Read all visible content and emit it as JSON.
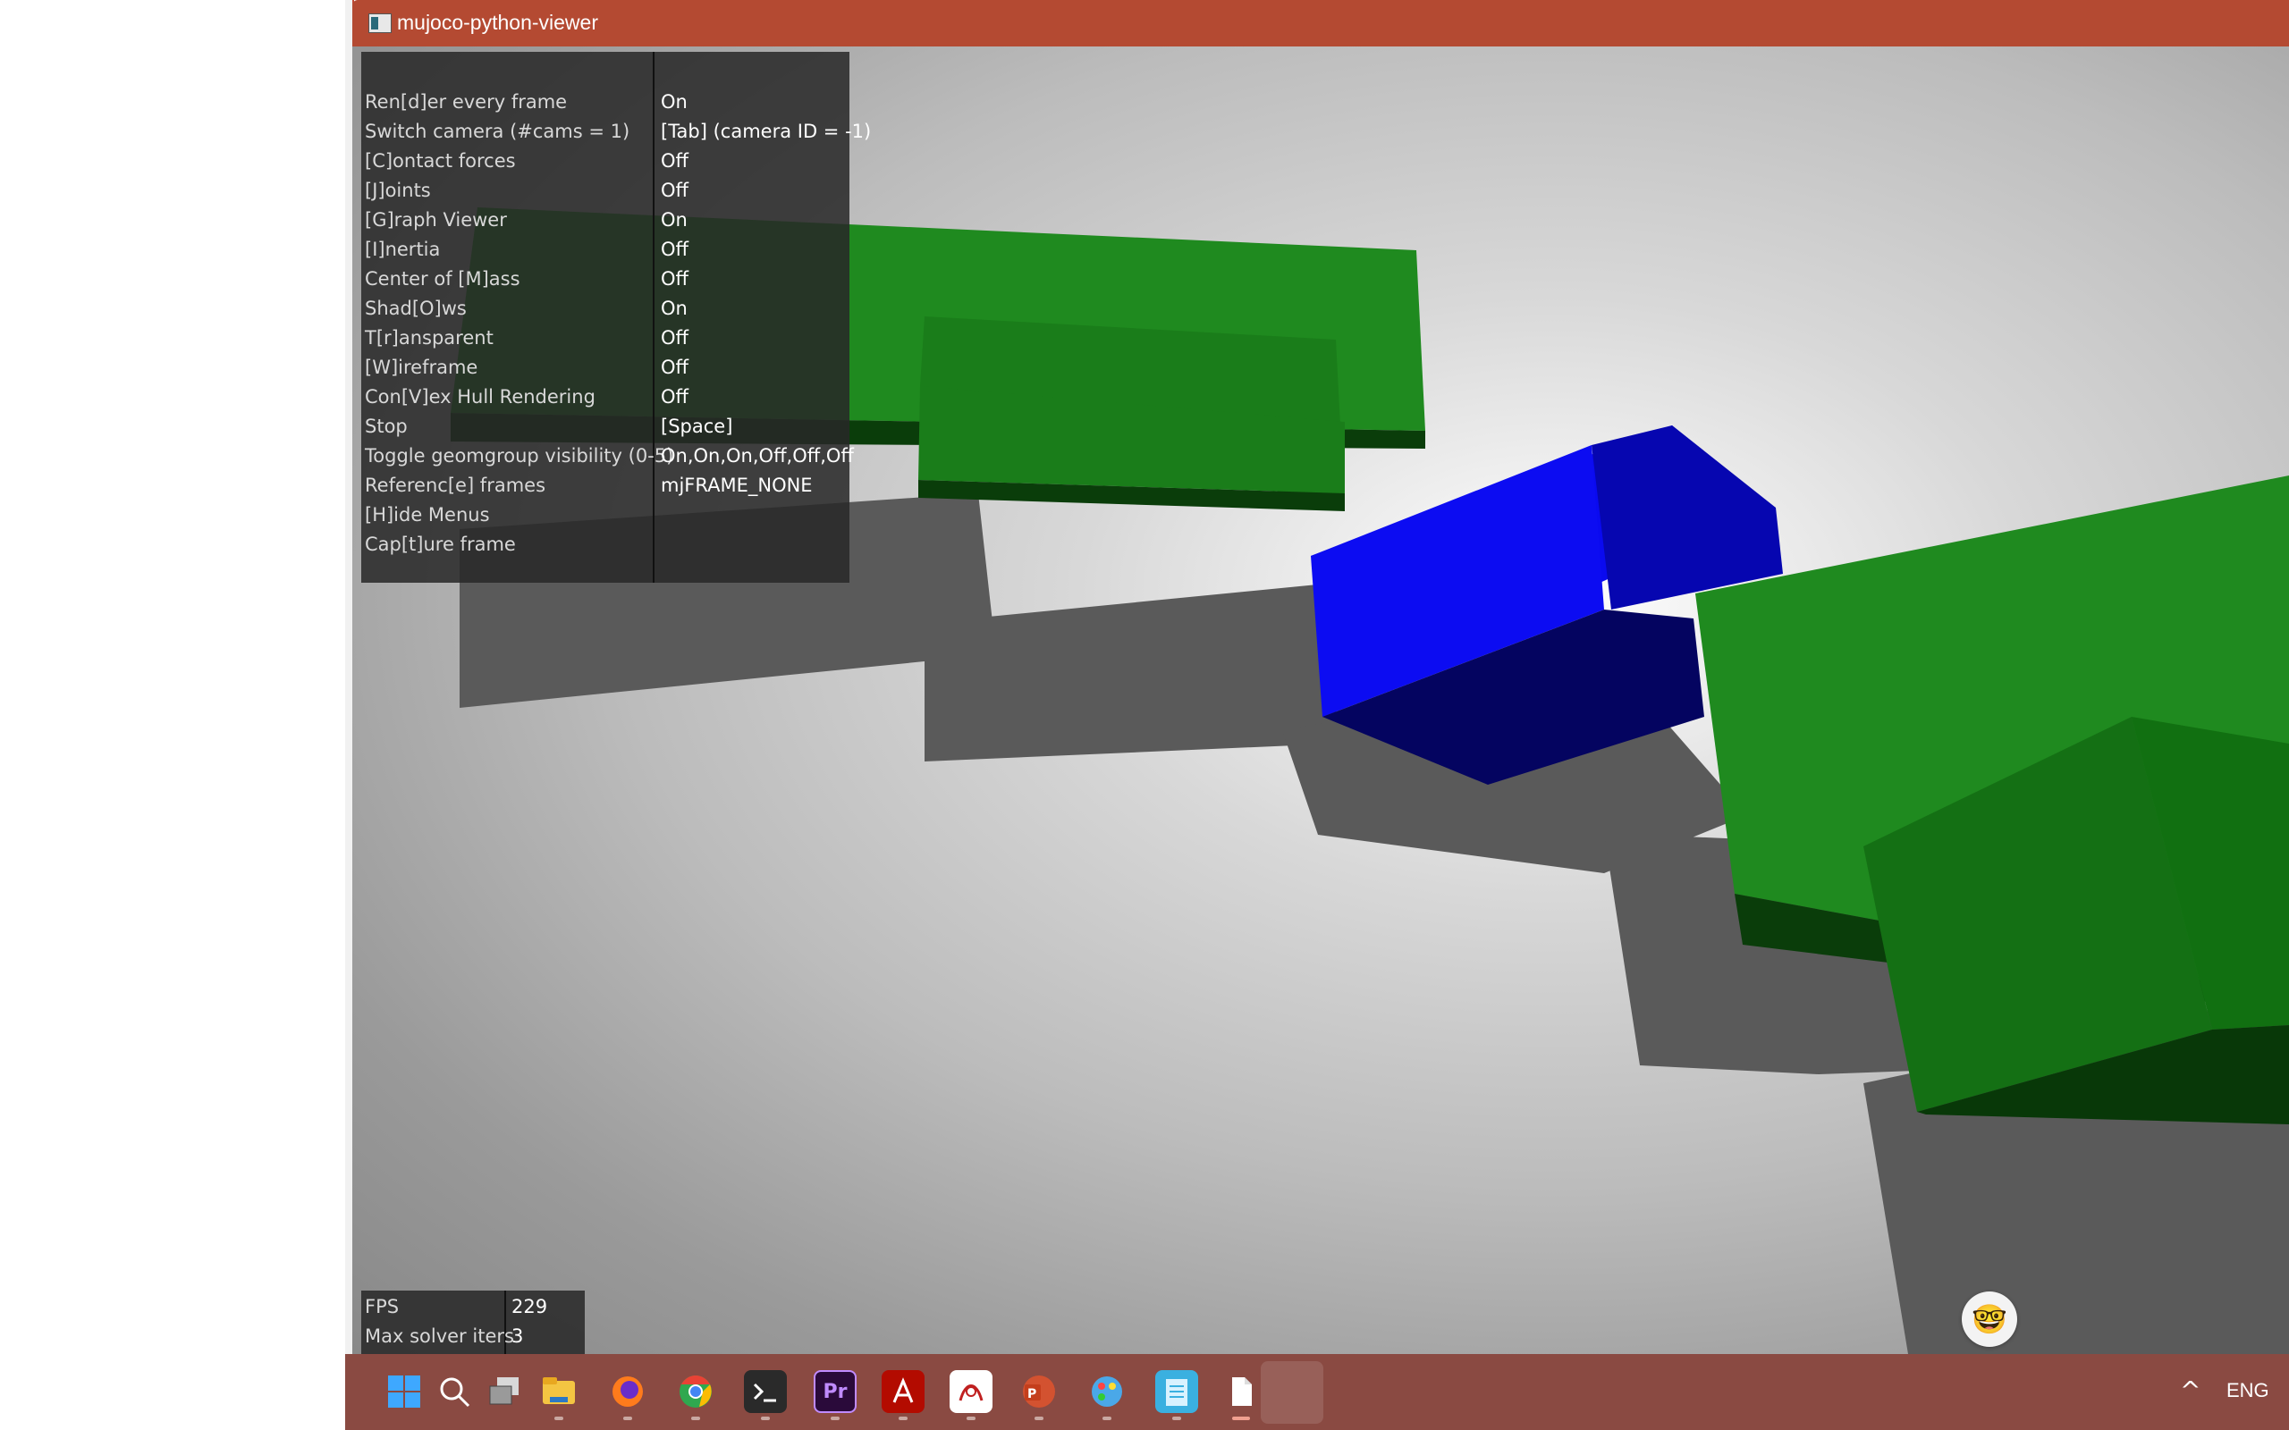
{
  "window": {
    "title": "mujoco-python-viewer"
  },
  "menu": {
    "rows": [
      {
        "label": "Ren[d]er every frame",
        "value": "On"
      },
      {
        "label": "Switch camera (#cams = 1)",
        "value": "[Tab] (camera ID = -1)"
      },
      {
        "label": "[C]ontact forces",
        "value": "Off"
      },
      {
        "label": "[J]oints",
        "value": "Off"
      },
      {
        "label": "[G]raph Viewer",
        "value": "On"
      },
      {
        "label": "[I]nertia",
        "value": "Off"
      },
      {
        "label": "Center of [M]ass",
        "value": "Off"
      },
      {
        "label": "Shad[O]ws",
        "value": "On"
      },
      {
        "label": "T[r]ansparent",
        "value": "Off"
      },
      {
        "label": "[W]ireframe",
        "value": "Off"
      },
      {
        "label": "Con[V]ex Hull Rendering",
        "value": "Off"
      },
      {
        "label": "Stop",
        "value": "[Space]"
      },
      {
        "label": "Toggle geomgroup visibility (0-5)",
        "value": "On,On,On,Off,Off,Off"
      },
      {
        "label": "Referenc[e] frames",
        "value": "mjFRAME_NONE"
      },
      {
        "label": "[H]ide Menus",
        "value": ""
      },
      {
        "label": "Cap[t]ure frame",
        "value": ""
      }
    ]
  },
  "stats": {
    "fps_label": "FPS",
    "fps_value": "229",
    "solver_label": "Max solver iters",
    "solver_value": "3"
  },
  "scene": {
    "colors": {
      "green": "#1f8a1f",
      "blue": "#0a0af0",
      "floor": "#c8c8c8"
    }
  },
  "taskbar": {
    "icons": [
      "windows-start-icon",
      "search-icon",
      "task-view-icon",
      "file-explorer-icon",
      "firefox-icon",
      "chrome-icon",
      "terminal-icon",
      "premiere-pro-icon",
      "acrobat-icon",
      "sketch-app-icon",
      "powerpoint-icon",
      "paint-icon",
      "notepad-icon",
      "file-icon"
    ],
    "premiere_label": "Pr",
    "tray_chevron": "^",
    "language": "ENG"
  }
}
